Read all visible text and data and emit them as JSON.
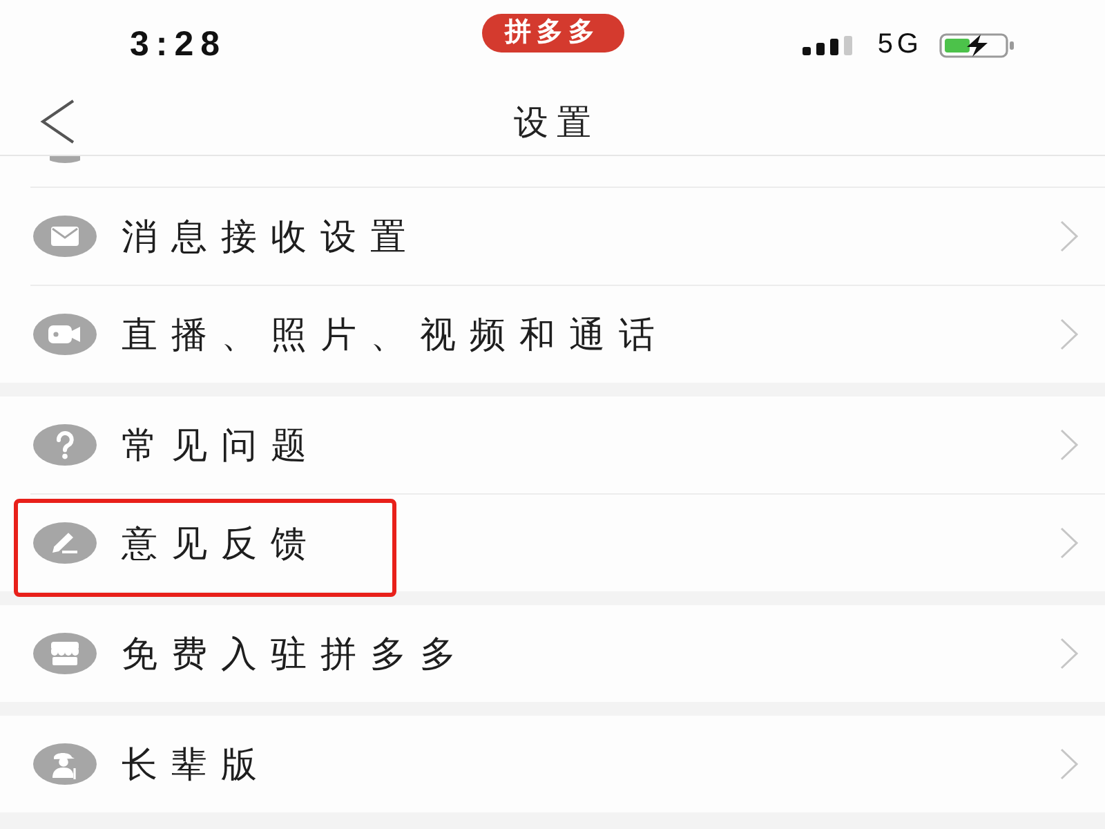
{
  "status_bar": {
    "time": "3:28",
    "app_badge": "拼多多",
    "network": "5G"
  },
  "nav_bar": {
    "title": "设置"
  },
  "groups": [
    {
      "cut_off_row": true,
      "items": [
        {
          "kind": "message",
          "label": "消息接收设置",
          "highlighted": false
        },
        {
          "kind": "video",
          "label": "直播、照片、视频和通话",
          "highlighted": false
        }
      ]
    },
    {
      "items": [
        {
          "kind": "help",
          "label": "常见问题",
          "highlighted": false
        },
        {
          "kind": "feedback",
          "label": "意见反馈",
          "highlighted": true
        }
      ]
    },
    {
      "items": [
        {
          "kind": "store",
          "label": "免费入驻拼多多",
          "highlighted": false
        }
      ]
    },
    {
      "items": [
        {
          "kind": "elder",
          "label": "长辈版",
          "highlighted": false
        }
      ]
    }
  ]
}
